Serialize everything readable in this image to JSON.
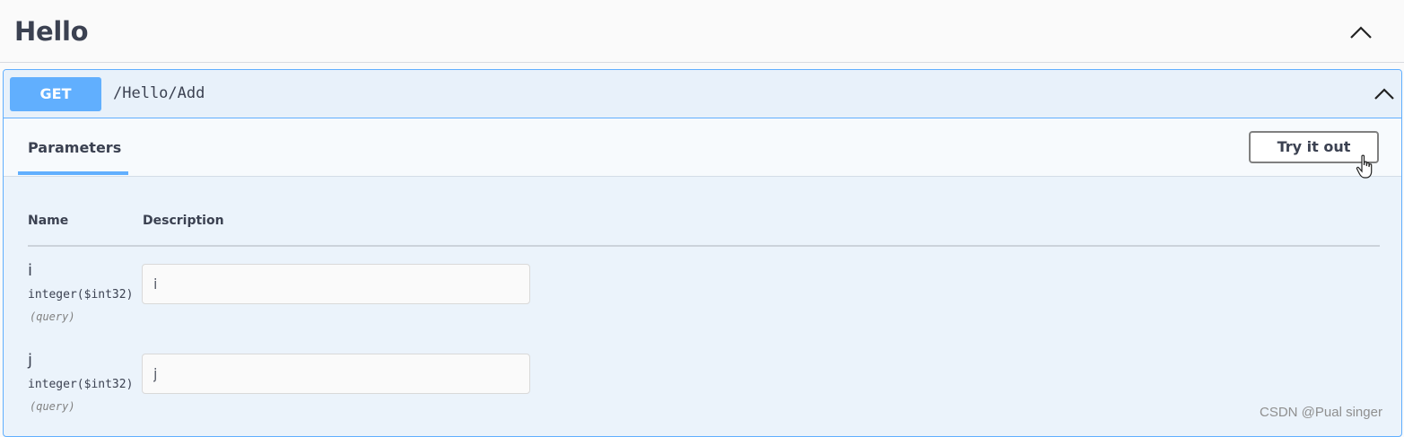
{
  "section": {
    "title": "Hello",
    "collapse_icon": "chevron-up-icon"
  },
  "operation": {
    "method": "GET",
    "path": "/Hello/Add",
    "collapse_icon": "chevron-up-icon",
    "method_color": "#61affe"
  },
  "tabs": {
    "parameters_label": "Parameters",
    "try_it_out_label": "Try it out"
  },
  "params_table": {
    "columns": [
      "Name",
      "Description"
    ],
    "rows": [
      {
        "name": "i",
        "type": "integer($int32)",
        "in": "(query)",
        "placeholder": "i"
      },
      {
        "name": "j",
        "type": "integer($int32)",
        "in": "(query)",
        "placeholder": "j"
      }
    ]
  },
  "watermark": "CSDN @Pual singer",
  "cursor_icon": "hand-pointer-icon"
}
